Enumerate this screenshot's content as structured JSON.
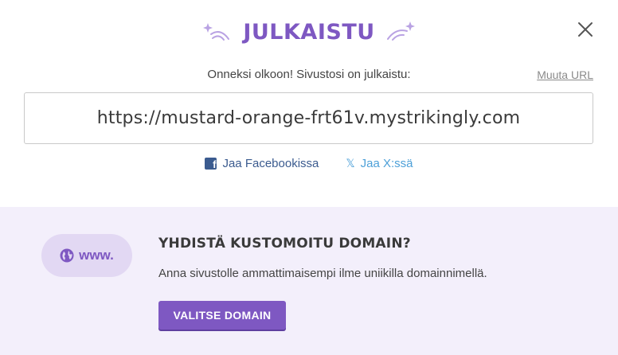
{
  "header": {
    "title": "JULKAISTU",
    "close_icon": "close-icon",
    "left_decoration": "shooting-star-icon",
    "right_decoration": "shooting-star-icon"
  },
  "published": {
    "message": "Onneksi olkoon! Sivustosi on julkaistu:",
    "change_url_label": "Muuta URL",
    "url": "https://mustard-orange-frt61v.mystrikingly.com"
  },
  "share": {
    "facebook_label": "Jaa Facebookissa",
    "facebook_icon": "facebook-icon",
    "x_label": "Jaa X:ssä",
    "x_icon": "x-icon"
  },
  "domain": {
    "pill_text": "www.",
    "pill_icon": "globe-icon",
    "title": "YHDISTÄ KUSTOMOITU DOMAIN?",
    "description": "Anna sivustolle ammattimaisempi ilme uniikilla domainnimellä.",
    "button_label": "VALITSE DOMAIN"
  },
  "colors": {
    "accent": "#7e58c2",
    "section_bg": "#f3effb",
    "pill_bg": "#e2d8f3",
    "facebook": "#3b5b8f",
    "x_link": "#4da0d8"
  }
}
